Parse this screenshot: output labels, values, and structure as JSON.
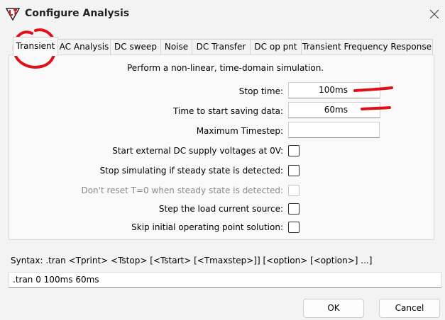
{
  "window": {
    "title": "Configure Analysis",
    "icon": "ltspice-logo-icon",
    "close_icon": "close-icon"
  },
  "tabs": [
    {
      "label": "Transient",
      "active": true
    },
    {
      "label": "AC Analysis"
    },
    {
      "label": "DC sweep"
    },
    {
      "label": "Noise"
    },
    {
      "label": "DC Transfer"
    },
    {
      "label": "DC op pnt"
    },
    {
      "label": "Transient Frequency Response"
    }
  ],
  "transient": {
    "description": "Perform a non-linear, time-domain simulation.",
    "fields": [
      {
        "label": "Stop time:",
        "value": "100ms"
      },
      {
        "label": "Time to start saving data:",
        "value": "60ms"
      },
      {
        "label": "Maximum Timestep:",
        "value": ""
      }
    ],
    "options": [
      {
        "label": "Start external DC supply voltages at 0V:",
        "checked": false,
        "enabled": true
      },
      {
        "label": "Stop simulating if steady state is detected:",
        "checked": false,
        "enabled": true
      },
      {
        "label": "Don't reset T=0 when steady state is detected:",
        "checked": false,
        "enabled": false
      },
      {
        "label": "Step the load current source:",
        "checked": false,
        "enabled": true
      },
      {
        "label": "Skip initial operating point solution:",
        "checked": false,
        "enabled": true
      }
    ]
  },
  "syntax": {
    "text": "Syntax:  .tran <Tprint> <Tstop> [<Tstart> [<Tmaxstep>]] [<option> [<option>] ...]"
  },
  "command": {
    "value": ".tran 0 100ms 60ms"
  },
  "buttons": {
    "ok": "OK",
    "cancel": "Cancel"
  },
  "colors": {
    "annotation": "#e0101b",
    "panel_bg": "#f9f9f9",
    "window_bg": "#f3f3f3"
  }
}
